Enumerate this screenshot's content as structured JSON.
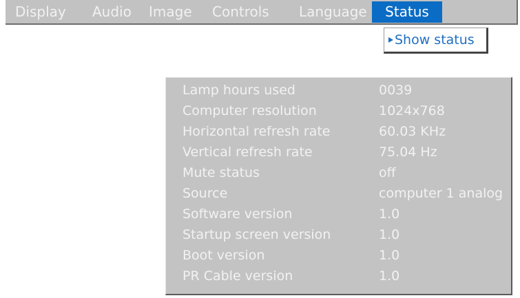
{
  "menubar": {
    "items": [
      {
        "label": "Display"
      },
      {
        "label": "Audio"
      },
      {
        "label": "Image"
      },
      {
        "label": "Controls"
      },
      {
        "label": "Language"
      },
      {
        "label": "Status",
        "active": true
      }
    ]
  },
  "submenu": {
    "items": [
      {
        "label": "Show status",
        "icon": "arrow-right-icon"
      }
    ]
  },
  "status_panel": {
    "rows": [
      {
        "label": "Lamp hours used",
        "value": "0039"
      },
      {
        "label": "Computer resolution",
        "value": "1024x768"
      },
      {
        "label": "Horizontal refresh rate",
        "value": "60.03 KHz"
      },
      {
        "label": "Vertical refresh rate",
        "value": "75.04 Hz"
      },
      {
        "label": "Mute status",
        "value": "off"
      },
      {
        "label": "Source",
        "value": "computer 1 analog"
      },
      {
        "label": "Software version",
        "value": "1.0"
      },
      {
        "label": "Startup screen version",
        "value": "1.0"
      },
      {
        "label": "Boot version",
        "value": "1.0"
      },
      {
        "label": "PR Cable version",
        "value": "1.0"
      }
    ]
  },
  "colors": {
    "menubar_bg": "#c2c2c2",
    "active_tab": "#0a6cc4",
    "submenu_text": "#1f6fc0",
    "panel_bg": "#c3c3c3",
    "panel_text": "#f2f2f2"
  }
}
